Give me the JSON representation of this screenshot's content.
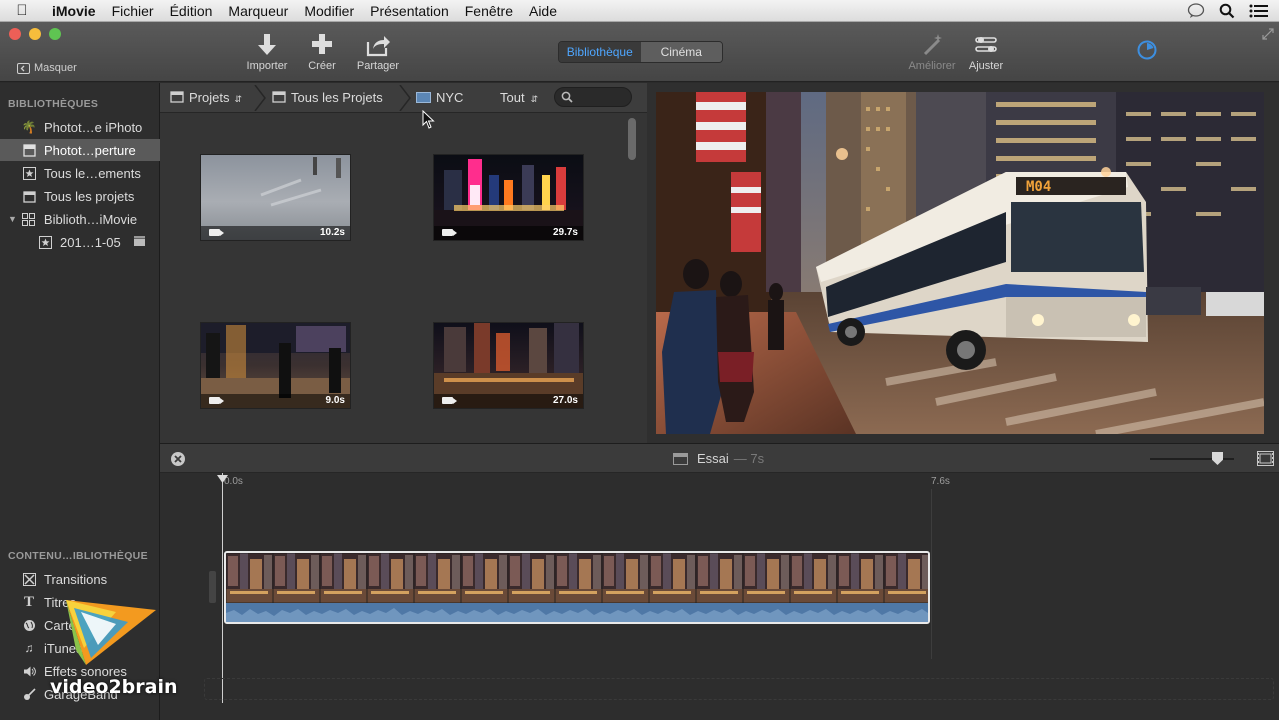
{
  "menubar": {
    "app": "iMovie",
    "items": [
      "Fichier",
      "Édition",
      "Marqueur",
      "Modifier",
      "Présentation",
      "Fenêtre",
      "Aide"
    ]
  },
  "toolbar": {
    "hide_label": "Masquer",
    "import_label": "Importer",
    "create_label": "Créer",
    "share_label": "Partager",
    "segment": {
      "library": "Bibliothèque",
      "cinema": "Cinéma"
    },
    "enhance_label": "Améliorer",
    "adjust_label": "Ajuster"
  },
  "sidebar": {
    "libraries_heading": "BIBLIOTHÈQUES",
    "items": [
      {
        "label": "Photot…e iPhoto",
        "icon": "iphoto-icon"
      },
      {
        "label": "Photot…perture",
        "icon": "aperture-icon",
        "selected": true
      },
      {
        "label": "Tous le…ements",
        "icon": "star-icon"
      },
      {
        "label": "Tous les projets",
        "icon": "projects-icon"
      },
      {
        "label": "Biblioth…iMovie",
        "icon": "grid-icon"
      },
      {
        "label": "201…1-05",
        "icon": "star-icon"
      }
    ],
    "content_heading": "CONTENU…IBLIOTHÈQUE",
    "content_items": [
      {
        "label": "Transitions",
        "icon": "transitions-icon"
      },
      {
        "label": "Titres",
        "icon": "title-icon"
      },
      {
        "label": "Cartes et fonds",
        "icon": "globe-icon"
      },
      {
        "label": "iTunes",
        "icon": "music-icon"
      },
      {
        "label": "Effets sonores",
        "icon": "speaker-icon"
      },
      {
        "label": "GarageBand",
        "icon": "guitar-icon"
      }
    ]
  },
  "browser": {
    "crumb1": "Projets",
    "crumb2": "Tous les Projets",
    "crumb3": "NYC",
    "filter": "Tout",
    "clips": [
      {
        "duration": "10.2s"
      },
      {
        "duration": "29.7s"
      },
      {
        "duration": "9.0s"
      },
      {
        "duration": "27.0s"
      }
    ]
  },
  "timeline": {
    "project_name": "Essai",
    "project_duration": "— 7s",
    "ruler_start": "0.0s",
    "ruler_end": "7.6s"
  },
  "watermark": {
    "text": "video2brain"
  }
}
